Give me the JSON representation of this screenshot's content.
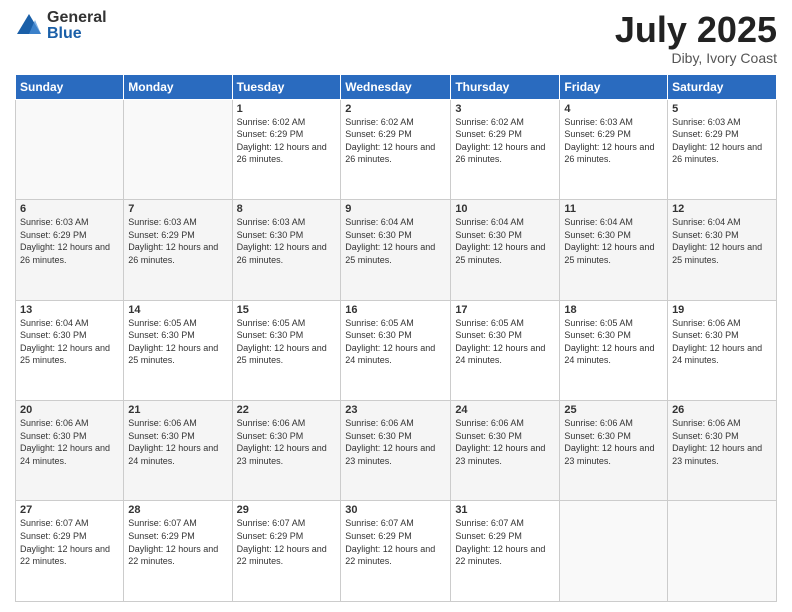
{
  "logo": {
    "general": "General",
    "blue": "Blue"
  },
  "title": "July 2025",
  "location": "Diby, Ivory Coast",
  "days_header": [
    "Sunday",
    "Monday",
    "Tuesday",
    "Wednesday",
    "Thursday",
    "Friday",
    "Saturday"
  ],
  "weeks": [
    [
      {
        "num": "",
        "info": ""
      },
      {
        "num": "",
        "info": ""
      },
      {
        "num": "1",
        "info": "Sunrise: 6:02 AM\nSunset: 6:29 PM\nDaylight: 12 hours and 26 minutes."
      },
      {
        "num": "2",
        "info": "Sunrise: 6:02 AM\nSunset: 6:29 PM\nDaylight: 12 hours and 26 minutes."
      },
      {
        "num": "3",
        "info": "Sunrise: 6:02 AM\nSunset: 6:29 PM\nDaylight: 12 hours and 26 minutes."
      },
      {
        "num": "4",
        "info": "Sunrise: 6:03 AM\nSunset: 6:29 PM\nDaylight: 12 hours and 26 minutes."
      },
      {
        "num": "5",
        "info": "Sunrise: 6:03 AM\nSunset: 6:29 PM\nDaylight: 12 hours and 26 minutes."
      }
    ],
    [
      {
        "num": "6",
        "info": "Sunrise: 6:03 AM\nSunset: 6:29 PM\nDaylight: 12 hours and 26 minutes."
      },
      {
        "num": "7",
        "info": "Sunrise: 6:03 AM\nSunset: 6:29 PM\nDaylight: 12 hours and 26 minutes."
      },
      {
        "num": "8",
        "info": "Sunrise: 6:03 AM\nSunset: 6:30 PM\nDaylight: 12 hours and 26 minutes."
      },
      {
        "num": "9",
        "info": "Sunrise: 6:04 AM\nSunset: 6:30 PM\nDaylight: 12 hours and 25 minutes."
      },
      {
        "num": "10",
        "info": "Sunrise: 6:04 AM\nSunset: 6:30 PM\nDaylight: 12 hours and 25 minutes."
      },
      {
        "num": "11",
        "info": "Sunrise: 6:04 AM\nSunset: 6:30 PM\nDaylight: 12 hours and 25 minutes."
      },
      {
        "num": "12",
        "info": "Sunrise: 6:04 AM\nSunset: 6:30 PM\nDaylight: 12 hours and 25 minutes."
      }
    ],
    [
      {
        "num": "13",
        "info": "Sunrise: 6:04 AM\nSunset: 6:30 PM\nDaylight: 12 hours and 25 minutes."
      },
      {
        "num": "14",
        "info": "Sunrise: 6:05 AM\nSunset: 6:30 PM\nDaylight: 12 hours and 25 minutes."
      },
      {
        "num": "15",
        "info": "Sunrise: 6:05 AM\nSunset: 6:30 PM\nDaylight: 12 hours and 25 minutes."
      },
      {
        "num": "16",
        "info": "Sunrise: 6:05 AM\nSunset: 6:30 PM\nDaylight: 12 hours and 24 minutes."
      },
      {
        "num": "17",
        "info": "Sunrise: 6:05 AM\nSunset: 6:30 PM\nDaylight: 12 hours and 24 minutes."
      },
      {
        "num": "18",
        "info": "Sunrise: 6:05 AM\nSunset: 6:30 PM\nDaylight: 12 hours and 24 minutes."
      },
      {
        "num": "19",
        "info": "Sunrise: 6:06 AM\nSunset: 6:30 PM\nDaylight: 12 hours and 24 minutes."
      }
    ],
    [
      {
        "num": "20",
        "info": "Sunrise: 6:06 AM\nSunset: 6:30 PM\nDaylight: 12 hours and 24 minutes."
      },
      {
        "num": "21",
        "info": "Sunrise: 6:06 AM\nSunset: 6:30 PM\nDaylight: 12 hours and 24 minutes."
      },
      {
        "num": "22",
        "info": "Sunrise: 6:06 AM\nSunset: 6:30 PM\nDaylight: 12 hours and 23 minutes."
      },
      {
        "num": "23",
        "info": "Sunrise: 6:06 AM\nSunset: 6:30 PM\nDaylight: 12 hours and 23 minutes."
      },
      {
        "num": "24",
        "info": "Sunrise: 6:06 AM\nSunset: 6:30 PM\nDaylight: 12 hours and 23 minutes."
      },
      {
        "num": "25",
        "info": "Sunrise: 6:06 AM\nSunset: 6:30 PM\nDaylight: 12 hours and 23 minutes."
      },
      {
        "num": "26",
        "info": "Sunrise: 6:06 AM\nSunset: 6:30 PM\nDaylight: 12 hours and 23 minutes."
      }
    ],
    [
      {
        "num": "27",
        "info": "Sunrise: 6:07 AM\nSunset: 6:29 PM\nDaylight: 12 hours and 22 minutes."
      },
      {
        "num": "28",
        "info": "Sunrise: 6:07 AM\nSunset: 6:29 PM\nDaylight: 12 hours and 22 minutes."
      },
      {
        "num": "29",
        "info": "Sunrise: 6:07 AM\nSunset: 6:29 PM\nDaylight: 12 hours and 22 minutes."
      },
      {
        "num": "30",
        "info": "Sunrise: 6:07 AM\nSunset: 6:29 PM\nDaylight: 12 hours and 22 minutes."
      },
      {
        "num": "31",
        "info": "Sunrise: 6:07 AM\nSunset: 6:29 PM\nDaylight: 12 hours and 22 minutes."
      },
      {
        "num": "",
        "info": ""
      },
      {
        "num": "",
        "info": ""
      }
    ]
  ]
}
